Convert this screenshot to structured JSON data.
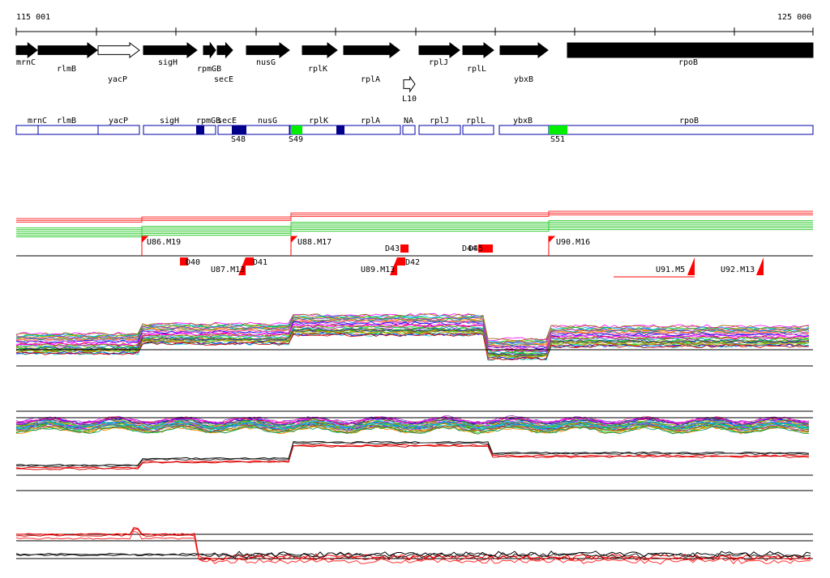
{
  "ruler": {
    "start_label": "115 001",
    "end_label": "125 000"
  },
  "genes": [
    {
      "name": "mrnC",
      "strand": "+",
      "filled": true
    },
    {
      "name": "rlmB",
      "strand": "+",
      "filled": true
    },
    {
      "name": "yacP",
      "strand": "+",
      "filled": false
    },
    {
      "name": "sigH",
      "strand": "+",
      "filled": true
    },
    {
      "name": "rpmGB",
      "strand": "+",
      "filled": true
    },
    {
      "name": "secE",
      "strand": "+",
      "filled": true
    },
    {
      "name": "nusG",
      "strand": "+",
      "filled": true
    },
    {
      "name": "rplK",
      "strand": "+",
      "filled": true
    },
    {
      "name": "rplA",
      "strand": "+",
      "filled": true
    },
    {
      "name": "L10",
      "strand": "+",
      "filled": false
    },
    {
      "name": "rplJ",
      "strand": "+",
      "filled": true
    },
    {
      "name": "rplL",
      "strand": "+",
      "filled": true
    },
    {
      "name": "ybxB",
      "strand": "+",
      "filled": true
    },
    {
      "name": "rpoB",
      "strand": "+",
      "filled": true
    }
  ],
  "segments": [
    {
      "name": "mrnC"
    },
    {
      "name": "rlmB"
    },
    {
      "name": "yacP"
    },
    {
      "name": "sigH"
    },
    {
      "name": "rpmGB"
    },
    {
      "name": "secE"
    },
    {
      "name": "nusG"
    },
    {
      "name": "rplK"
    },
    {
      "name": "rplA"
    },
    {
      "name": "NA"
    },
    {
      "name": "rplJ"
    },
    {
      "name": "rplL"
    },
    {
      "name": "ybxB"
    },
    {
      "name": "rpoB"
    }
  ],
  "segment_marks": [
    {
      "label": "S48",
      "color": "#00008b"
    },
    {
      "label": "S49",
      "color": "#00ee00"
    },
    {
      "label": "S51",
      "color": "#00ee00"
    }
  ],
  "transcripts_up": [
    {
      "label": "U86.M19"
    },
    {
      "label": "U88.M17"
    },
    {
      "label": "U90.M16"
    }
  ],
  "transcripts_down": [
    {
      "label": "U87.M13"
    },
    {
      "label": "U89.M13"
    },
    {
      "label": "U91.M5"
    },
    {
      "label": "U92.M13"
    }
  ],
  "down_marks": [
    {
      "label": "D40"
    },
    {
      "label": "D41"
    },
    {
      "label": "D42"
    },
    {
      "label": "D43"
    },
    {
      "label": "D44"
    },
    {
      "label": "D45"
    }
  ],
  "colors": {
    "gene_fill": "#000000",
    "segment_border": "#0000aa",
    "transcript": "#ff0000",
    "accent_green": "#00ee00",
    "dark_blue": "#00008b"
  }
}
